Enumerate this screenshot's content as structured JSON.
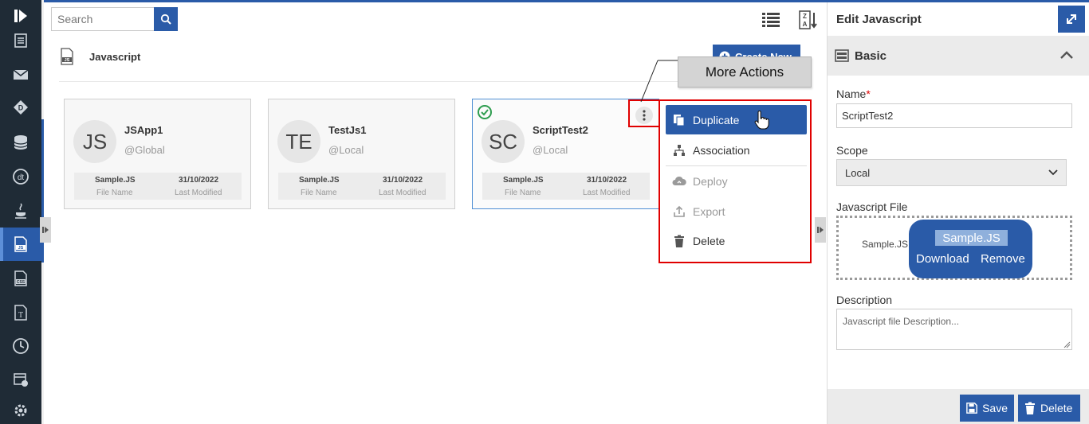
{
  "search": {
    "placeholder": "Search"
  },
  "section": {
    "title": "Javascript"
  },
  "create_button": {
    "label": "Create New"
  },
  "cards": [
    {
      "initials": "JS",
      "name": "JSApp1",
      "scope": "@Global",
      "file_name": "Sample.JS",
      "file_name_label": "File Name",
      "last_modified": "31/10/2022",
      "last_modified_label": "Last Modified",
      "selected": false
    },
    {
      "initials": "TE",
      "name": "TestJs1",
      "scope": "@Local",
      "file_name": "Sample.JS",
      "file_name_label": "File Name",
      "last_modified": "31/10/2022",
      "last_modified_label": "Last Modified",
      "selected": false
    },
    {
      "initials": "SC",
      "name": "ScriptTest2",
      "scope": "@Local",
      "file_name": "Sample.JS",
      "file_name_label": "File Name",
      "last_modified": "31/10/2022",
      "last_modified_label": "Last Modified",
      "selected": true
    }
  ],
  "tooltip": {
    "label": "More Actions"
  },
  "menu": {
    "items": [
      {
        "label": "Duplicate",
        "icon": "copy-icon",
        "state": "highlighted"
      },
      {
        "label": "Association",
        "icon": "sitemap-icon",
        "state": "enabled"
      },
      {
        "label": "Deploy",
        "icon": "cloud-icon",
        "state": "disabled"
      },
      {
        "label": "Export",
        "icon": "export-icon",
        "state": "disabled"
      },
      {
        "label": "Delete",
        "icon": "trash-icon",
        "state": "enabled"
      }
    ]
  },
  "panel": {
    "title": "Edit Javascript",
    "section": "Basic",
    "name_label": "Name",
    "required_mark": "*",
    "name_value": "ScriptTest2",
    "scope_label": "Scope",
    "scope_value": "Local",
    "file_label": "Javascript File",
    "file_value": "Sample.JS",
    "file_pill_name": "Sample.JS",
    "download_label": "Download",
    "remove_label": "Remove",
    "description_label": "Description",
    "description_placeholder": "Javascript file Description...",
    "save_label": "Save",
    "delete_label": "Delete"
  },
  "colors": {
    "accent": "#2a5ba8",
    "rail": "#1f2b36",
    "highlight_box": "#e00000",
    "check": "#2e9d4f"
  }
}
